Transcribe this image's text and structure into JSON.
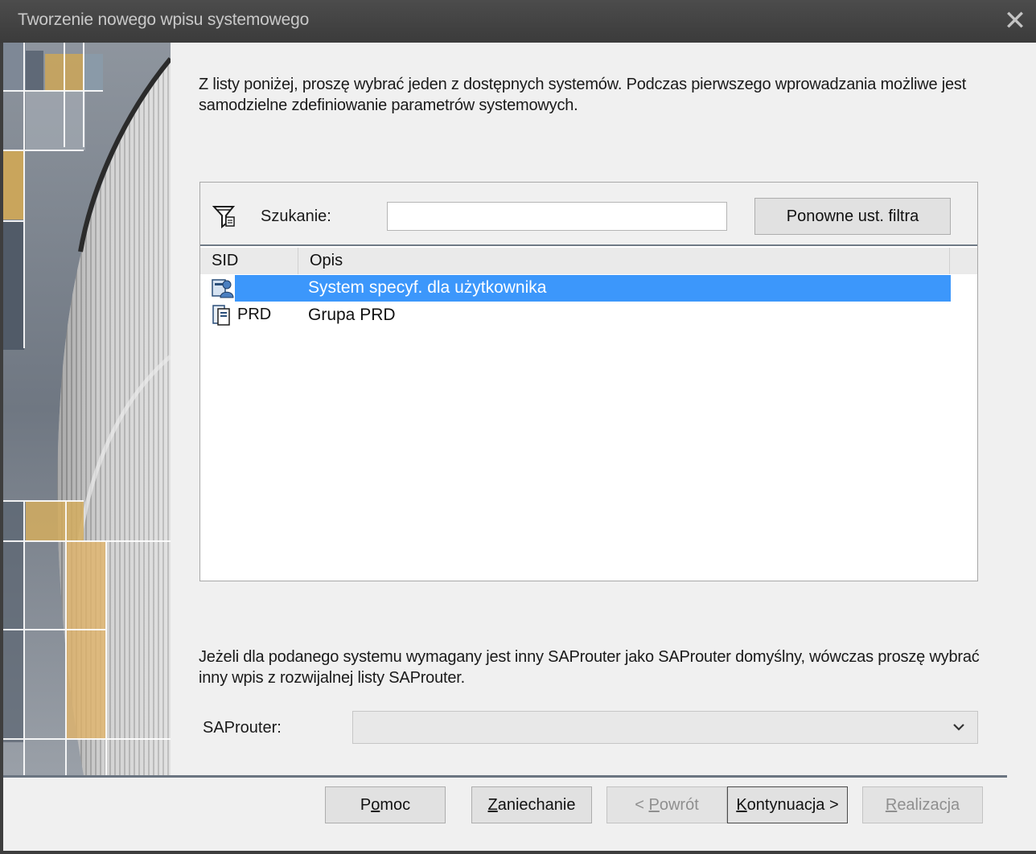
{
  "window": {
    "title": "Tworzenie nowego wpisu systemowego",
    "close_icon": "close-icon"
  },
  "intro_text": "Z listy poniżej, proszę wybrać jeden z dostępnych systemów. Podczas pierwszego wprowadzania możliwe jest samodzielne zdefiniowanie parametrów systemowych.",
  "filter": {
    "icon": "filter-icon",
    "search_label": "Szukanie:",
    "search_value": "",
    "reset_button": "Ponowne ust. filtra"
  },
  "table": {
    "columns": [
      "SID",
      "Opis"
    ],
    "rows": [
      {
        "icon": "user-system-icon",
        "sid": "",
        "opis": "System specyf. dla użytkownika",
        "selected": true
      },
      {
        "icon": "server-group-icon",
        "sid": "PRD",
        "opis": "Grupa PRD",
        "selected": false
      }
    ]
  },
  "saprouter": {
    "text": "Jeżeli dla podanego systemu wymagany jest inny SAProuter jako SAProuter domyślny, wówczas proszę wybrać inny wpis z rozwijalnej listy SAProuter.",
    "label": "SAProuter:",
    "value": ""
  },
  "buttons": {
    "help": {
      "pre": "P",
      "u": "o",
      "post": "moc"
    },
    "cancel": {
      "pre": "",
      "u": "Z",
      "post": "aniechanie"
    },
    "back": {
      "pre": "< ",
      "u": "P",
      "post": "owrót"
    },
    "next": {
      "pre": "",
      "u": "K",
      "post": "ontynuacja >"
    },
    "finish": {
      "pre": "",
      "u": "R",
      "post": "ealizacja"
    }
  },
  "colors": {
    "selection": "#3c97fb",
    "titlebar": "#3b3b3b"
  }
}
